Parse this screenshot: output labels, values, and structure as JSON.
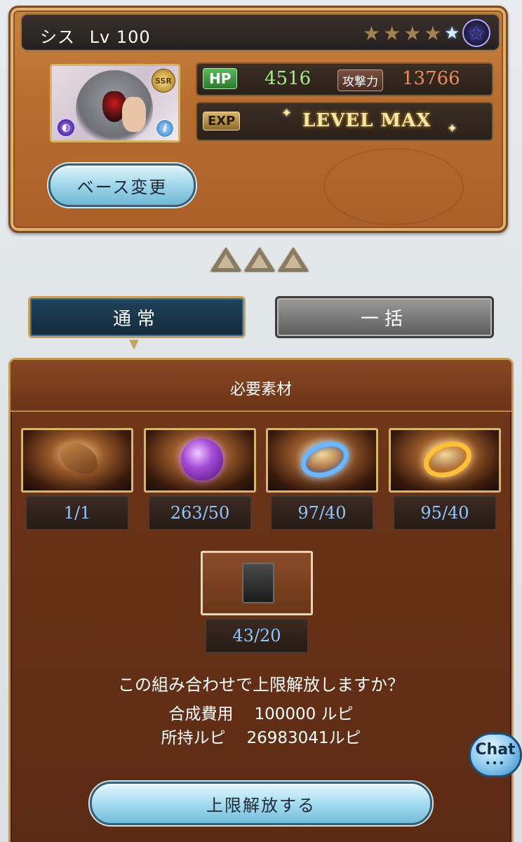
{
  "character": {
    "name": "シス",
    "level_label": "Lv 100",
    "rarity": "SSR",
    "stars": {
      "filled": 4,
      "blue": 1,
      "special": 1
    },
    "hp_label": "HP",
    "hp_value": "4516",
    "atk_label": "攻撃力",
    "atk_value": "13766",
    "exp_label": "EXP",
    "exp_status": "LEVEL MAX",
    "base_change_label": "ベース変更"
  },
  "uncap_indicator": {
    "count": 3
  },
  "modes": {
    "normal_label": "通常",
    "bulk_label": "一括",
    "active": "normal"
  },
  "materials": {
    "title": "必要素材",
    "items": [
      {
        "icon": "gauntlet-icon",
        "count": "1/1"
      },
      {
        "icon": "purple-orb-icon",
        "count": "263/50"
      },
      {
        "icon": "blue-ring-icon",
        "count": "97/40"
      },
      {
        "icon": "gold-ring-icon",
        "count": "95/40"
      },
      {
        "icon": "black-block-icon",
        "count": "43/20"
      }
    ]
  },
  "confirm": {
    "question": "この組み合わせで上限解放しますか？",
    "cost_label": "合成費用",
    "cost_value": "100000 ルピ",
    "owned_label": "所持ルピ",
    "owned_value": "26983041ルピ",
    "button_label": "上限解放する"
  },
  "chat": {
    "label": "Chat"
  },
  "colors": {
    "hp": "#a6ec8a",
    "atk": "#f08a56",
    "count": "#8ec6ff",
    "panel": "#6b3318",
    "accent_gold": "#c79a54"
  }
}
